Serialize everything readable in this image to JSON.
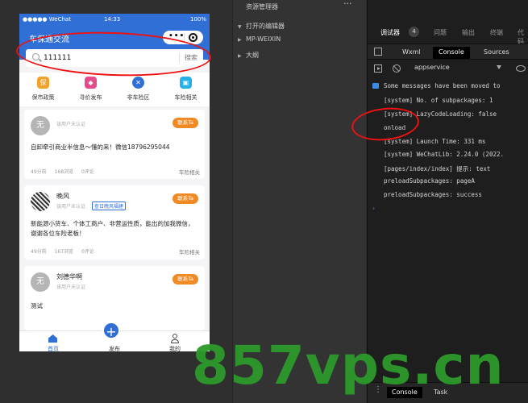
{
  "simulator": {
    "status_bar": {
      "carrier": "●●●●● WeChat",
      "time": "14:33",
      "battery": "100%"
    },
    "nav_title": "车保通交流",
    "capsule_more": "•••",
    "search": {
      "value": "111111",
      "button": "搜索"
    },
    "quick_nav": [
      {
        "label": "保市政策",
        "icon": "保",
        "color": "#f0a22a"
      },
      {
        "label": "寻价发布",
        "icon": "◆",
        "color": "#e54b8c"
      },
      {
        "label": "非车险区",
        "icon": "✕",
        "color": "#2f6fd6"
      },
      {
        "label": "车险相关",
        "icon": "▣",
        "color": "#27b0e6"
      }
    ],
    "posts": [
      {
        "avatar": "无",
        "name": "",
        "auth": "该用户未认证",
        "verify_tag": "",
        "contact": "联系Ta",
        "content": "自卸牵引商业半信息～懂的来！微信18796295044",
        "time": "49分前",
        "views": "168浏览",
        "comments": "0评论",
        "category": "车险相关"
      },
      {
        "avatar": "",
        "name": "晚风",
        "auth": "该用户未认证",
        "verify_tag": "查日晚风福建",
        "contact": "联系Ta",
        "content": "新能源小货车、个体工商户、非营运性质，能出的加我微信，谢谢各位车险老板！",
        "time": "49分前",
        "views": "167浏览",
        "comments": "0评论",
        "category": "车险相关"
      },
      {
        "avatar": "无",
        "name": "刘德华啊",
        "auth": "该用户未认证",
        "verify_tag": "",
        "contact": "联系Ta",
        "content": "测试"
      }
    ],
    "tabs": {
      "home": "首页",
      "publish": "发布",
      "me": "我的"
    }
  },
  "explorer": {
    "title": "资源管理器",
    "more": "···",
    "items": [
      "打开的编辑器",
      "MP-WEIXIN",
      "大纲"
    ]
  },
  "devtools": {
    "tabs": [
      "调试器",
      "问题",
      "输出",
      "终端",
      "代码"
    ],
    "badge": "4",
    "sub_tabs": [
      "Wxml",
      "Console",
      "Sources"
    ],
    "context": "appservice",
    "logs": [
      "Some messages have been moved to",
      "[system] No. of subpackages: 1",
      "[system] LazyCodeLoading: false",
      "onload",
      "[system] Launch Time: 331 ms",
      "[system] WeChatLib: 2.24.0 (2022.",
      "[pages/index/index]  提示:  text",
      "preloadSubpackages: pageA",
      "preloadSubpackages: success"
    ],
    "prompt": "›",
    "bottom_tabs": [
      "Console",
      "Task"
    ]
  },
  "watermark": "857vps.cn"
}
